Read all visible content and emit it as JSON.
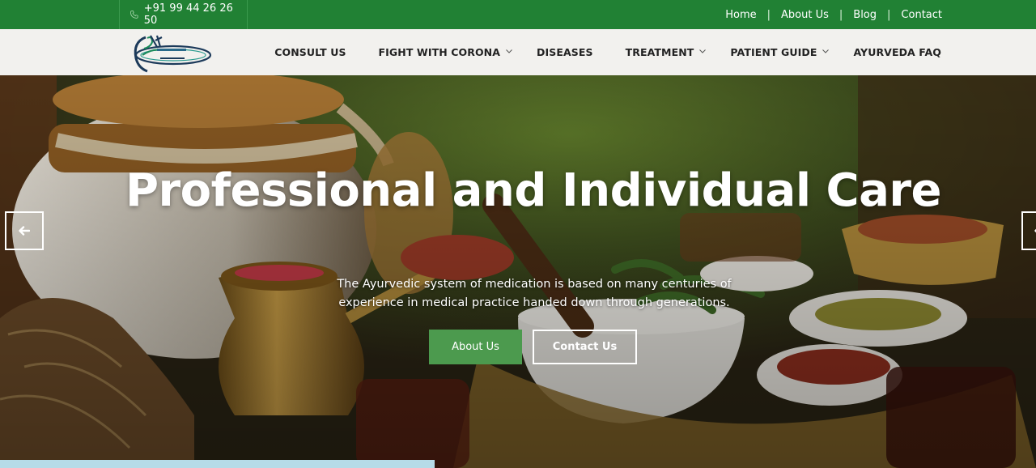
{
  "topbar": {
    "phone": "+91 99 44 26 26 50",
    "links": [
      "Home",
      "About Us",
      "Blog",
      "Contact"
    ],
    "separator": "|"
  },
  "nav": {
    "items": [
      {
        "label": "CONSULT US",
        "dropdown": false
      },
      {
        "label": "FIGHT WITH CORONA",
        "dropdown": true
      },
      {
        "label": "DISEASES",
        "dropdown": false
      },
      {
        "label": "TREATMENT",
        "dropdown": true
      },
      {
        "label": "PATIENT GUIDE",
        "dropdown": true
      },
      {
        "label": "AYURVEDA FAQ",
        "dropdown": false
      }
    ],
    "chevron_icon": "chevron-down-icon"
  },
  "hero": {
    "title": "Professional and Individual Care",
    "text": "The Ayurvedic system of medication is based on many centuries of experience in medical practice handed down through generations.",
    "primary_button": "About Us",
    "secondary_button": "Contact Us",
    "prev_icon": "arrow-left-icon",
    "next_icon": "arrow-left-icon"
  },
  "colors": {
    "topbar": "#218134",
    "header": "#f2f1ee",
    "button_green": "#4c9a4e",
    "strip": "#b6dbe8"
  }
}
